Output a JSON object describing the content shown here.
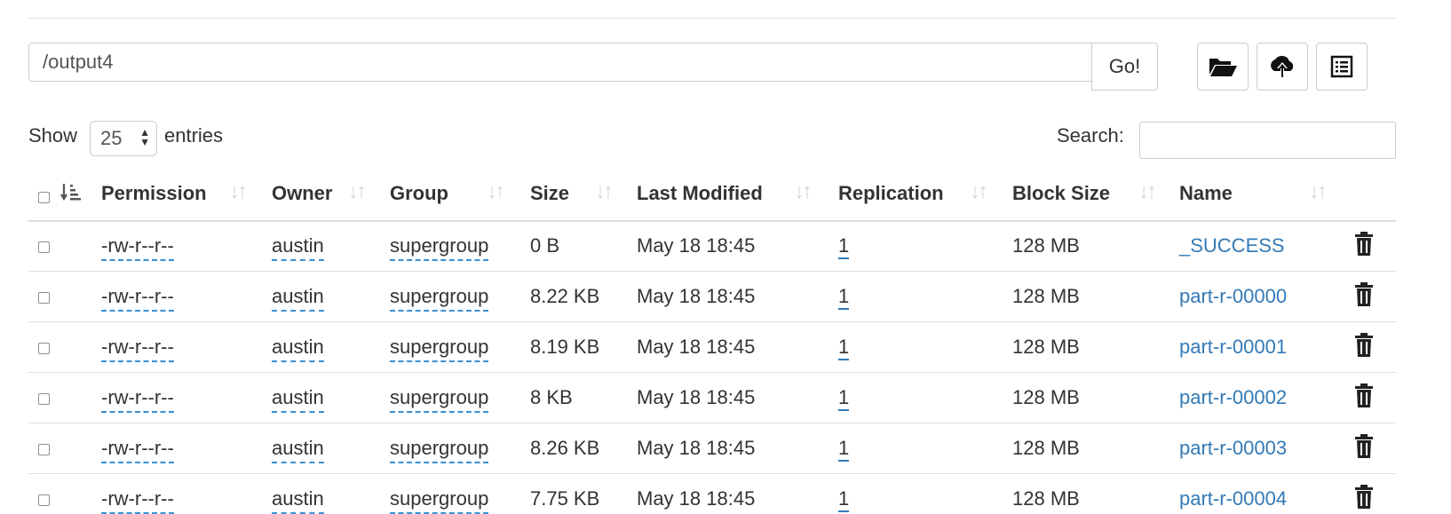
{
  "path": {
    "value": "/output4",
    "go_label": "Go!"
  },
  "toolbar": {
    "icons": [
      "open-folder-icon",
      "cloud-upload-icon",
      "list-icon"
    ]
  },
  "table_controls": {
    "show_label": "Show",
    "page_length": "25",
    "entries_label": "entries",
    "search_label": "Search:",
    "search_value": ""
  },
  "columns": [
    "Permission",
    "Owner",
    "Group",
    "Size",
    "Last Modified",
    "Replication",
    "Block Size",
    "Name"
  ],
  "rows": [
    {
      "permission": "-rw-r--r--",
      "owner": "austin",
      "group": "supergroup",
      "size": "0 B",
      "modified": "May 18 18:45",
      "replication": "1",
      "block_size": "128 MB",
      "name": "_SUCCESS"
    },
    {
      "permission": "-rw-r--r--",
      "owner": "austin",
      "group": "supergroup",
      "size": "8.22 KB",
      "modified": "May 18 18:45",
      "replication": "1",
      "block_size": "128 MB",
      "name": "part-r-00000"
    },
    {
      "permission": "-rw-r--r--",
      "owner": "austin",
      "group": "supergroup",
      "size": "8.19 KB",
      "modified": "May 18 18:45",
      "replication": "1",
      "block_size": "128 MB",
      "name": "part-r-00001"
    },
    {
      "permission": "-rw-r--r--",
      "owner": "austin",
      "group": "supergroup",
      "size": "8 KB",
      "modified": "May 18 18:45",
      "replication": "1",
      "block_size": "128 MB",
      "name": "part-r-00002"
    },
    {
      "permission": "-rw-r--r--",
      "owner": "austin",
      "group": "supergroup",
      "size": "8.26 KB",
      "modified": "May 18 18:45",
      "replication": "1",
      "block_size": "128 MB",
      "name": "part-r-00003"
    },
    {
      "permission": "-rw-r--r--",
      "owner": "austin",
      "group": "supergroup",
      "size": "7.75 KB",
      "modified": "May 18 18:45",
      "replication": "1",
      "block_size": "128 MB",
      "name": "part-r-00004"
    }
  ],
  "colors": {
    "link": "#337ab7",
    "border": "#dddddd",
    "text": "#333333"
  }
}
